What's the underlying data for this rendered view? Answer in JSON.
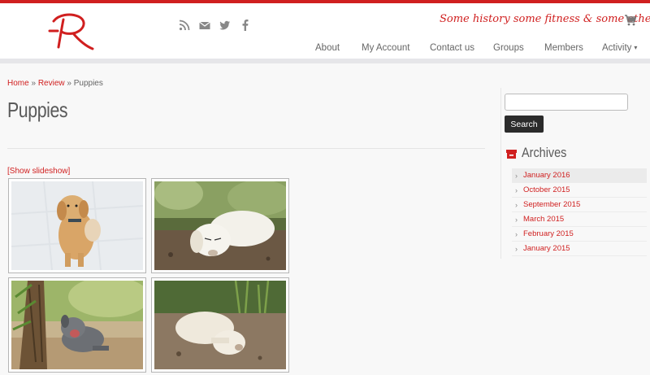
{
  "header": {
    "logo_alt": "R",
    "tagline": "Some history some fitness & some others",
    "social_icons": [
      "rss-icon",
      "mail-icon",
      "twitter-icon",
      "facebook-icon"
    ],
    "cart_icon": "cart-icon"
  },
  "nav": {
    "items": [
      "About",
      "My Account",
      "Contact us",
      "Groups",
      "Members",
      "Activity"
    ],
    "activity_caret": "▾"
  },
  "breadcrumb": {
    "home": "Home",
    "sep1": " » ",
    "review": "Review",
    "sep2": " » ",
    "current": "Puppies"
  },
  "main": {
    "title": "Puppies",
    "slideshow_link": "[Show slideshow]",
    "gallery": [
      {
        "name": "puppy-golden-standing"
      },
      {
        "name": "puppy-white-sleeping"
      },
      {
        "name": "puppy-grey-yawning"
      },
      {
        "name": "puppy-white-lying"
      }
    ]
  },
  "sidebar": {
    "search_placeholder": "",
    "search_button": "Search",
    "archives_title": "Archives",
    "archives": [
      "January 2016",
      "October 2015",
      "September 2015",
      "March 2015",
      "February 2015",
      "January 2015"
    ],
    "active_index": 0
  },
  "colors": {
    "accent": "#d01f1f",
    "page_bg": "#f8f8f8",
    "band": "#e6e6e9"
  }
}
